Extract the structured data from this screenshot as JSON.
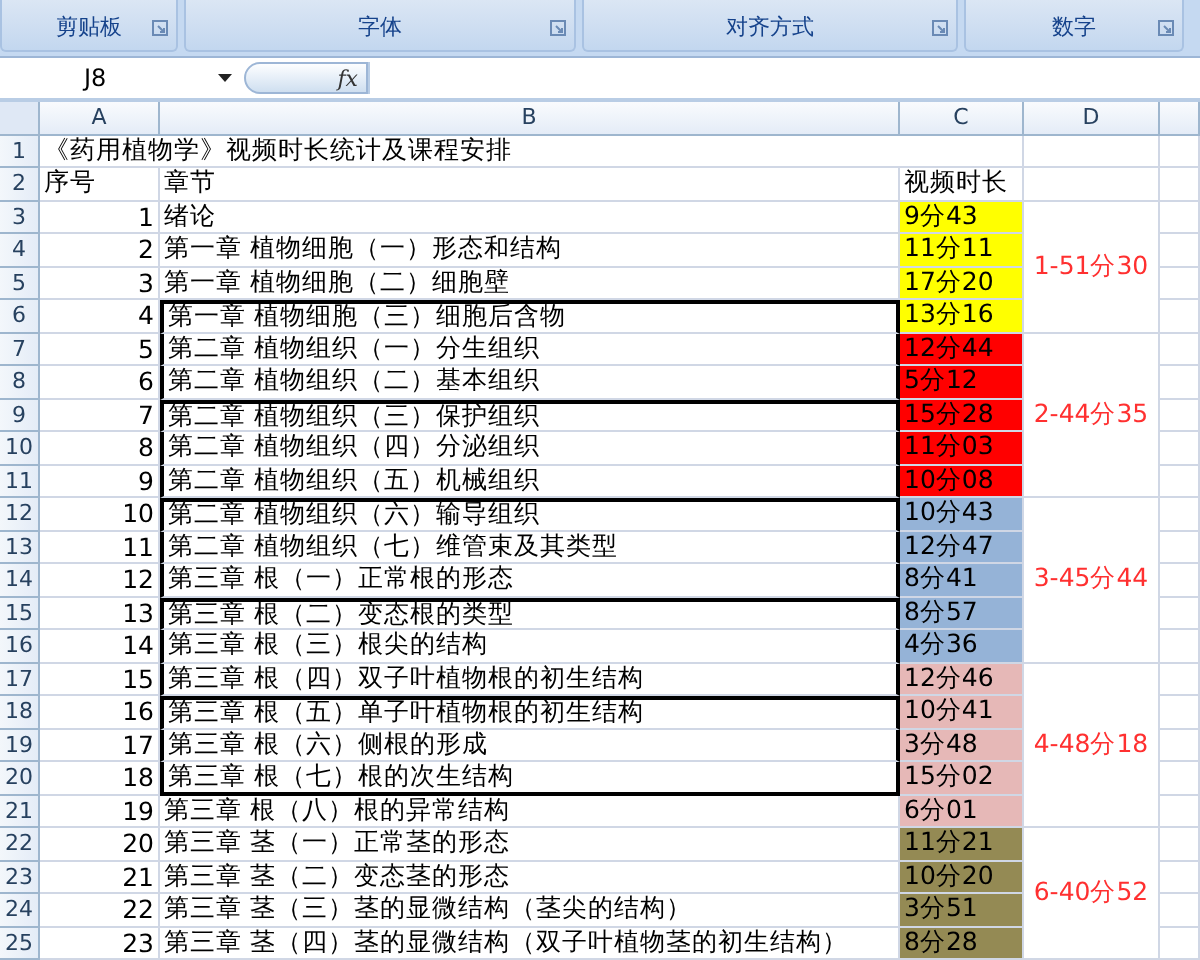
{
  "ribbon": {
    "groups": [
      "剪贴板",
      "字体",
      "对齐方式",
      "数字"
    ]
  },
  "formula_bar": {
    "name_box": "J8",
    "fx": "fx"
  },
  "columns": [
    "A",
    "B",
    "C",
    "D"
  ],
  "title_row": {
    "number": "1",
    "text": "《药用植物学》视频时长统计及课程安排"
  },
  "header_row": {
    "number": "2",
    "seq": "序号",
    "chapter": "章节",
    "duration": "视频时长"
  },
  "sections": [
    {
      "total": "1-51分30",
      "color": "#ffff00",
      "rows": [
        {
          "number": "3",
          "seq": "1",
          "chapter": "绪论",
          "duration": "9分43",
          "boxed": false,
          "box_top": false
        },
        {
          "number": "4",
          "seq": "2",
          "chapter": "第一章 植物细胞（一）形态和结构",
          "duration": "11分11",
          "boxed": false,
          "box_top": false
        },
        {
          "number": "5",
          "seq": "3",
          "chapter": "第一章 植物细胞（二）细胞壁",
          "duration": "17分20",
          "boxed": false,
          "box_top": false
        },
        {
          "number": "6",
          "seq": "4",
          "chapter": "第一章 植物细胞（三）细胞后含物",
          "duration": "13分16",
          "boxed": true,
          "box_top": true
        }
      ]
    },
    {
      "total": "2-44分35",
      "color": "#ff0000",
      "rows": [
        {
          "number": "7",
          "seq": "5",
          "chapter": "第二章 植物组织（一）分生组织",
          "duration": "12分44",
          "boxed": true,
          "box_top": false
        },
        {
          "number": "8",
          "seq": "6",
          "chapter": "第二章 植物组织（二）基本组织",
          "duration": "5分12",
          "boxed": true,
          "box_top": false
        },
        {
          "number": "9",
          "seq": "7",
          "chapter": "第二章 植物组织（三）保护组织",
          "duration": "15分28",
          "boxed": true,
          "box_top": true
        },
        {
          "number": "10",
          "seq": "8",
          "chapter": "第二章 植物组织（四）分泌组织",
          "duration": "11分03",
          "boxed": true,
          "box_top": false
        },
        {
          "number": "11",
          "seq": "9",
          "chapter": "第二章 植物组织（五）机械组织",
          "duration": "10分08",
          "boxed": true,
          "box_top": false
        }
      ]
    },
    {
      "total": "3-45分44",
      "color": "#95b3d7",
      "rows": [
        {
          "number": "12",
          "seq": "10",
          "chapter": "第二章 植物组织（六）输导组织",
          "duration": "10分43",
          "boxed": true,
          "box_top": true
        },
        {
          "number": "13",
          "seq": "11",
          "chapter": "第二章 植物组织（七）维管束及其类型",
          "duration": "12分47",
          "boxed": true,
          "box_top": false
        },
        {
          "number": "14",
          "seq": "12",
          "chapter": "第三章 根（一）正常根的形态",
          "duration": "8分41",
          "boxed": true,
          "box_top": false
        },
        {
          "number": "15",
          "seq": "13",
          "chapter": "第三章 根（二）变态根的类型",
          "duration": "8分57",
          "boxed": true,
          "box_top": true
        },
        {
          "number": "16",
          "seq": "14",
          "chapter": "第三章 根（三）根尖的结构",
          "duration": "4分36",
          "boxed": true,
          "box_top": false
        }
      ]
    },
    {
      "total": "4-48分18",
      "color": "#e6b8b7",
      "rows": [
        {
          "number": "17",
          "seq": "15",
          "chapter": "第三章 根（四）双子叶植物根的初生结构",
          "duration": "12分46",
          "boxed": true,
          "box_top": false
        },
        {
          "number": "18",
          "seq": "16",
          "chapter": "第三章 根（五）单子叶植物根的初生结构",
          "duration": "10分41",
          "boxed": true,
          "box_top": true
        },
        {
          "number": "19",
          "seq": "17",
          "chapter": "第三章 根（六）侧根的形成",
          "duration": "3分48",
          "boxed": true,
          "box_top": false
        },
        {
          "number": "20",
          "seq": "18",
          "chapter": "第三章 根（七）根的次生结构",
          "duration": "15分02",
          "boxed": true,
          "box_top": false
        },
        {
          "number": "21",
          "seq": "19",
          "chapter": "第三章 根（八）根的异常结构",
          "duration": "6分01",
          "boxed": false,
          "box_top": false
        }
      ]
    },
    {
      "total": "6-40分52",
      "color": "#948a54",
      "rows": [
        {
          "number": "22",
          "seq": "20",
          "chapter": "第三章 茎（一）正常茎的形态",
          "duration": "11分21",
          "boxed": false,
          "box_top": false
        },
        {
          "number": "23",
          "seq": "21",
          "chapter": "第三章 茎（二）变态茎的形态",
          "duration": "10分20",
          "boxed": false,
          "box_top": false
        },
        {
          "number": "24",
          "seq": "22",
          "chapter": "第三章 茎（三）茎的显微结构（茎尖的结构）",
          "duration": "3分51",
          "boxed": false,
          "box_top": false
        },
        {
          "number": "25",
          "seq": "23",
          "chapter": "第三章 茎（四）茎的显微结构（双子叶植物茎的初生结构）",
          "duration": "8分28",
          "boxed": false,
          "box_top": false
        }
      ]
    }
  ]
}
